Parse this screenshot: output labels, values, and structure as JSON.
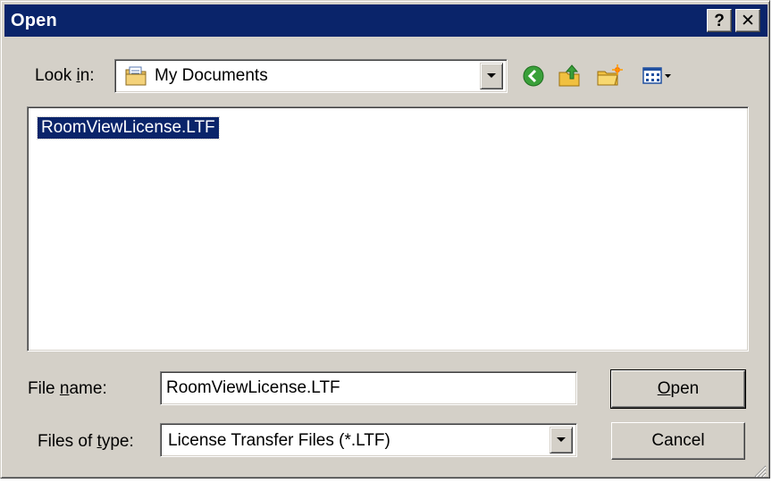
{
  "window": {
    "title": "Open",
    "help_glyph": "?",
    "close_glyph": "✕"
  },
  "look_in": {
    "label_pre": "Look ",
    "label_accel": "i",
    "label_post": "n:",
    "value": "My Documents",
    "icon": "my-documents-folder-icon"
  },
  "toolbar": {
    "back_icon": "back-arrow-icon",
    "up_icon": "up-one-level-icon",
    "new_folder_icon": "new-folder-icon",
    "views_icon": "views-menu-icon"
  },
  "file_list": {
    "items": [
      "RoomViewLicense.LTF"
    ]
  },
  "file_name": {
    "label_pre": "File ",
    "label_accel": "n",
    "label_post": "ame:",
    "value": "RoomViewLicense.LTF"
  },
  "files_of_type": {
    "label_pre": "Files of ",
    "label_accel": "t",
    "label_post": "ype:",
    "value": "License Transfer Files (*.LTF)"
  },
  "buttons": {
    "open_accel": "O",
    "open_rest": "pen",
    "cancel": "Cancel"
  },
  "colors": {
    "title_bar": "#0a246a",
    "face": "#d4d0c8",
    "selection": "#0a246a"
  }
}
